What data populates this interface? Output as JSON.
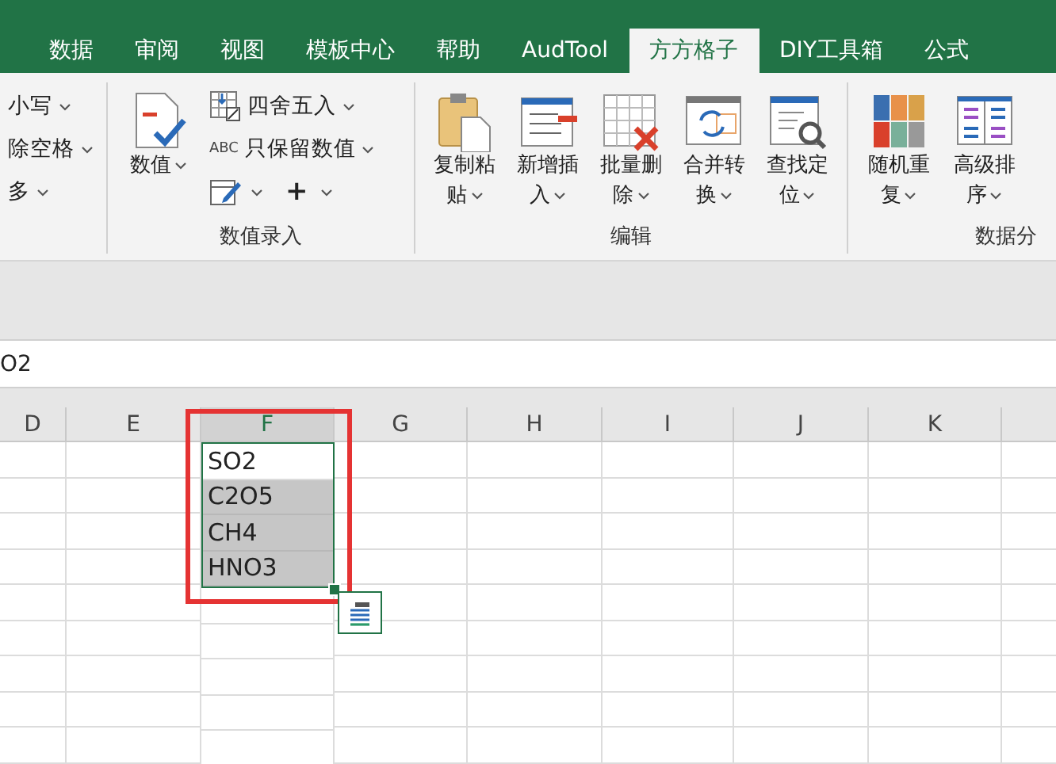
{
  "tabs": [
    {
      "label": "数据",
      "selected": false
    },
    {
      "label": "审阅",
      "selected": false
    },
    {
      "label": "视图",
      "selected": false
    },
    {
      "label": "模板中心",
      "selected": false
    },
    {
      "label": "帮助",
      "selected": false
    },
    {
      "label": "AudTool",
      "selected": false
    },
    {
      "label": "方方格子",
      "selected": true
    },
    {
      "label": "DIY工具箱",
      "selected": false
    },
    {
      "label": "公式",
      "selected": false
    }
  ],
  "ribbon": {
    "groups": [
      {
        "items": [
          {
            "kind": "small",
            "label": "小写"
          },
          {
            "kind": "small",
            "label": "除空格"
          },
          {
            "kind": "small",
            "label": "多"
          }
        ]
      },
      {
        "label": "数值录入",
        "items": [
          {
            "kind": "large",
            "label": "数值"
          },
          {
            "kind": "small",
            "label": "四舍五入"
          },
          {
            "kind": "small",
            "icon_text": "ABC",
            "label": "只保留数值"
          },
          {
            "kind": "inline"
          },
          {
            "kind": "inline",
            "label": "+"
          }
        ]
      },
      {
        "label": "编辑",
        "items": [
          {
            "kind": "large",
            "label": "复制粘贴"
          },
          {
            "kind": "large",
            "label": "新增插入"
          },
          {
            "kind": "large",
            "label": "批量删除"
          },
          {
            "kind": "large",
            "label": "合并转换"
          },
          {
            "kind": "large",
            "label": "查找定位"
          }
        ]
      },
      {
        "label": "数据分",
        "items": [
          {
            "kind": "large",
            "label": "随机重复"
          },
          {
            "kind": "large",
            "label": "高级排序"
          }
        ]
      }
    ]
  },
  "formula_bar": {
    "value": "O2"
  },
  "sheet": {
    "columns": [
      {
        "label": "D",
        "selected": false
      },
      {
        "label": "E",
        "selected": false
      },
      {
        "label": "F",
        "selected": true
      },
      {
        "label": "G",
        "selected": false
      },
      {
        "label": "H",
        "selected": false
      },
      {
        "label": "I",
        "selected": false
      },
      {
        "label": "J",
        "selected": false
      },
      {
        "label": "K",
        "selected": false
      }
    ],
    "cells": [
      {
        "value": "SO2",
        "active": true
      },
      {
        "value": "C2O5",
        "active": false
      },
      {
        "value": "CH4",
        "active": false
      },
      {
        "value": "HNO3",
        "active": false
      }
    ]
  }
}
